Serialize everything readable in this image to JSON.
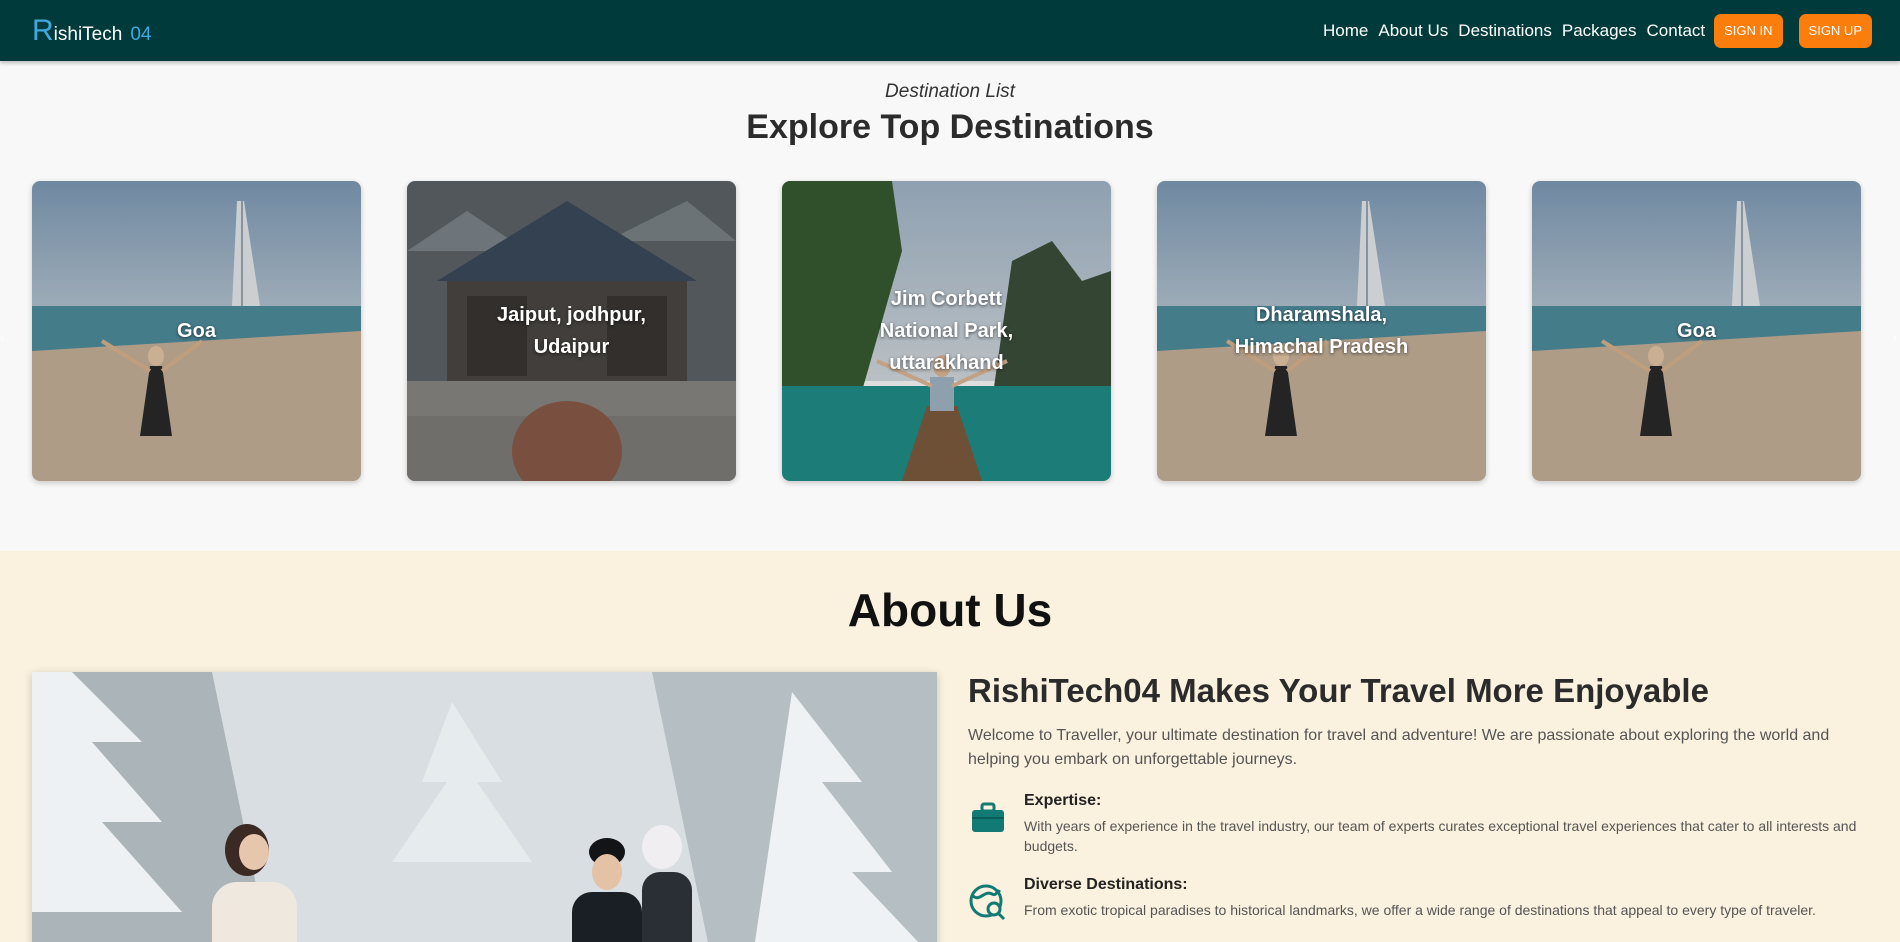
{
  "nav": {
    "brand_initial": "R",
    "brand_rest": "ishiTech",
    "brand_num": "04",
    "links": [
      "Home",
      "About Us",
      "Destinations",
      "Packages",
      "Contact"
    ],
    "sign_in": "SIGN IN",
    "sign_up": "SIGN UP"
  },
  "destinations": {
    "subtitle": "Destination List",
    "title": "Explore Top Destinations",
    "cards": [
      {
        "label": "Goa",
        "scene": "beach"
      },
      {
        "label": "Jaiput, jodhpur,\nUdaipur",
        "scene": "temple"
      },
      {
        "label": "Jim Corbett\nNational Park,\nuttarakhand",
        "scene": "boat"
      },
      {
        "label": "Dharamshala,\nHimachal Pradesh",
        "scene": "beach"
      },
      {
        "label": "Goa",
        "scene": "beach"
      }
    ]
  },
  "about": {
    "title": "About Us",
    "heading": "RishiTech04 Makes Your Travel More Enjoyable",
    "intro": "Welcome to Traveller, your ultimate destination for travel and adventure! We are passionate about exploring the world and helping you embark on unforgettable journeys.",
    "features": [
      {
        "icon": "briefcase-icon",
        "title": "Expertise:",
        "desc": "With years of experience in the travel industry, our team of experts curates exceptional travel experiences that cater to all interests and budgets."
      },
      {
        "icon": "globe-search-icon",
        "title": "Diverse Destinations:",
        "desc": "From exotic tropical paradises to historical landmarks, we offer a wide range of destinations that appeal to every type of traveler."
      }
    ]
  },
  "colors": {
    "nav_bg": "#013a3a",
    "accent_orange": "#fb7d0b",
    "brand_blue": "#3fa9e0",
    "about_bg": "#faf1de",
    "icon_teal": "#117a74"
  }
}
